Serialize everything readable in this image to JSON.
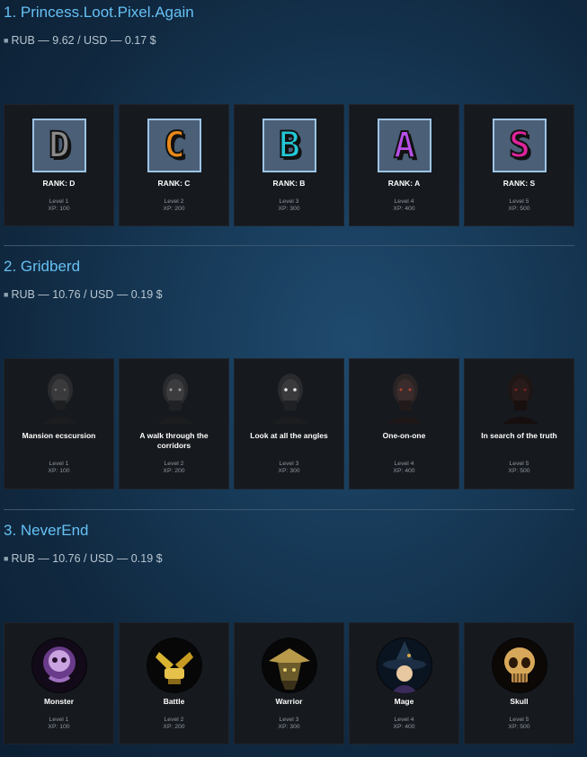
{
  "games": [
    {
      "title": "1. Princess.Loot.Pixel.Again",
      "price": "RUB — 9.62 / USD — 0.17 $",
      "cards": [
        {
          "name": "RANK: D",
          "level": "Level 1",
          "xp": "XP: 100",
          "letter": "D",
          "color": "#8a8a8a"
        },
        {
          "name": "RANK: C",
          "level": "Level 2",
          "xp": "XP: 200",
          "letter": "C",
          "color": "#e8891a"
        },
        {
          "name": "RANK: B",
          "level": "Level 3",
          "xp": "XP: 300",
          "letter": "B",
          "color": "#22c7d6"
        },
        {
          "name": "RANK: A",
          "level": "Level 4",
          "xp": "XP: 400",
          "letter": "A",
          "color": "#b84ee8"
        },
        {
          "name": "RANK: S",
          "level": "Level 5",
          "xp": "XP: 500",
          "letter": "S",
          "color": "#e0239e"
        }
      ]
    },
    {
      "title": "2. Gridberd",
      "price": "RUB — 10.76 / USD — 0.19 $",
      "cards": [
        {
          "name": "Mansion ecscursion",
          "level": "Level 1",
          "xp": "XP: 100"
        },
        {
          "name": "A walk through the corridors",
          "level": "Level 2",
          "xp": "XP: 200"
        },
        {
          "name": "Look at all the angles",
          "level": "Level 3",
          "xp": "XP: 300"
        },
        {
          "name": "One-on-one",
          "level": "Level 4",
          "xp": "XP: 400"
        },
        {
          "name": "In search of the truth",
          "level": "Level 5",
          "xp": "XP: 500"
        }
      ]
    },
    {
      "title": "3. NeverEnd",
      "price": "RUB — 10.76 / USD — 0.19 $",
      "cards": [
        {
          "name": "Monster",
          "level": "Level 1",
          "xp": "XP: 100",
          "icon": "monster-icon"
        },
        {
          "name": "Battle",
          "level": "Level 2",
          "xp": "XP: 200",
          "icon": "battle-icon"
        },
        {
          "name": "Warrior",
          "level": "Level 3",
          "xp": "XP: 300",
          "icon": "warrior-icon"
        },
        {
          "name": "Mage",
          "level": "Level 4",
          "xp": "XP: 400",
          "icon": "mage-icon"
        },
        {
          "name": "Skull",
          "level": "Level 5",
          "xp": "XP: 500",
          "icon": "skull-icon"
        }
      ]
    }
  ]
}
